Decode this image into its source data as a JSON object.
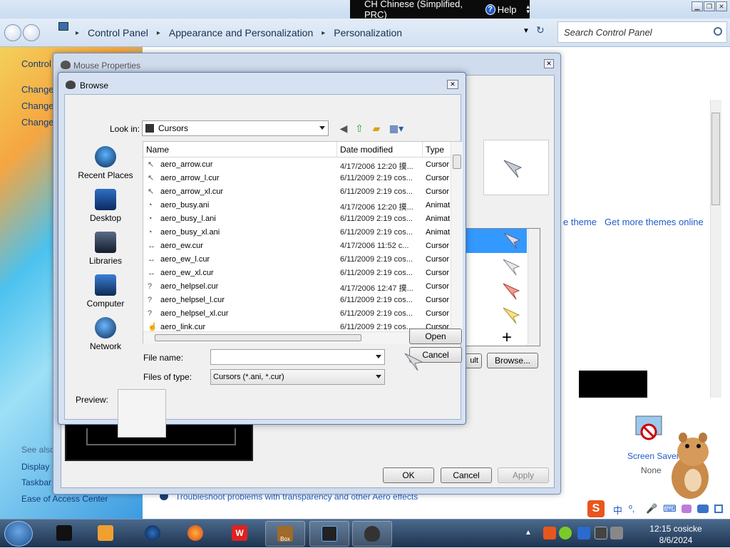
{
  "language_bar": {
    "language": "CH Chinese (Simplified, PRC)",
    "help": "Help"
  },
  "control_panel": {
    "breadcrumbs": [
      "Control Panel",
      "Appearance and Personalization",
      "Personalization"
    ],
    "search_placeholder": "Search Control Panel",
    "left_links": [
      "Control",
      "Change",
      "Change",
      "Change"
    ],
    "see_also": "See also",
    "see_also_links": [
      "Display",
      "Taskbar",
      "Ease of Access Center"
    ],
    "theme_links": [
      "e theme",
      "Get more themes online"
    ],
    "screen_saver_label": "Screen Saver",
    "screen_saver_value": "None",
    "troubleshoot_link": "Troubleshoot problems with transparency and other Aero effects"
  },
  "mouse_properties": {
    "title": "Mouse Properties",
    "buttons": {
      "ok": "OK",
      "cancel": "Cancel",
      "apply": "Apply"
    },
    "default_button_partial": "ult",
    "browse_button": "Browse..."
  },
  "browse_dialog": {
    "title": "Browse",
    "look_in_label": "Look in:",
    "look_in_value": "Cursors",
    "places": [
      "Recent Places",
      "Desktop",
      "Libraries",
      "Computer",
      "Network"
    ],
    "columns": [
      "Name",
      "Date modified",
      "Type"
    ],
    "files": [
      {
        "name": "aero_arrow.cur",
        "date": "4/17/2006 12:20 摸...",
        "type": "Cursor",
        "icon": "↖"
      },
      {
        "name": "aero_arrow_l.cur",
        "date": "6/11/2009 2:19 cos...",
        "type": "Cursor",
        "icon": "↖"
      },
      {
        "name": "aero_arrow_xl.cur",
        "date": "6/11/2009 2:19 cos...",
        "type": "Cursor",
        "icon": "↖"
      },
      {
        "name": "aero_busy.ani",
        "date": "4/17/2006 12:20 摸...",
        "type": "Animat",
        "icon": "◔"
      },
      {
        "name": "aero_busy_l.ani",
        "date": "6/11/2009 2:19 cos...",
        "type": "Animat",
        "icon": "◔"
      },
      {
        "name": "aero_busy_xl.ani",
        "date": "6/11/2009 2:19 cos...",
        "type": "Animat",
        "icon": "◔"
      },
      {
        "name": "aero_ew.cur",
        "date": "4/17/2006 11:52 c...",
        "type": "Cursor",
        "icon": "↔"
      },
      {
        "name": "aero_ew_l.cur",
        "date": "6/11/2009 2:19 cos...",
        "type": "Cursor",
        "icon": "↔"
      },
      {
        "name": "aero_ew_xl.cur",
        "date": "6/11/2009 2:19 cos...",
        "type": "Cursor",
        "icon": "↔"
      },
      {
        "name": "aero_helpsel.cur",
        "date": "4/17/2006 12:47 摸...",
        "type": "Cursor",
        "icon": "?"
      },
      {
        "name": "aero_helpsel_l.cur",
        "date": "6/11/2009 2:19 cos...",
        "type": "Cursor",
        "icon": "?"
      },
      {
        "name": "aero_helpsel_xl.cur",
        "date": "6/11/2009 2:19 cos...",
        "type": "Cursor",
        "icon": "?"
      },
      {
        "name": "aero_link.cur",
        "date": "6/11/2009 2:19 cos...",
        "type": "Cursor",
        "icon": "☝"
      }
    ],
    "file_name_label": "File name:",
    "file_name_value": "",
    "files_of_type_label": "Files of type:",
    "files_of_type_value": "Cursors (*.ani, *.cur)",
    "open_button": "Open",
    "cancel_button": "Cancel",
    "preview_label": "Preview:"
  },
  "taskbar": {
    "clock_time": "12:15 cosicke",
    "clock_date": "8/6/2024",
    "app_box_label": "Box"
  },
  "ime": {
    "items": [
      "中",
      "º,",
      "🎤",
      "⌨"
    ]
  },
  "colors": {
    "selection": "#3399ff",
    "link": "#1e5cc8",
    "taskbar": "#1d3350"
  }
}
